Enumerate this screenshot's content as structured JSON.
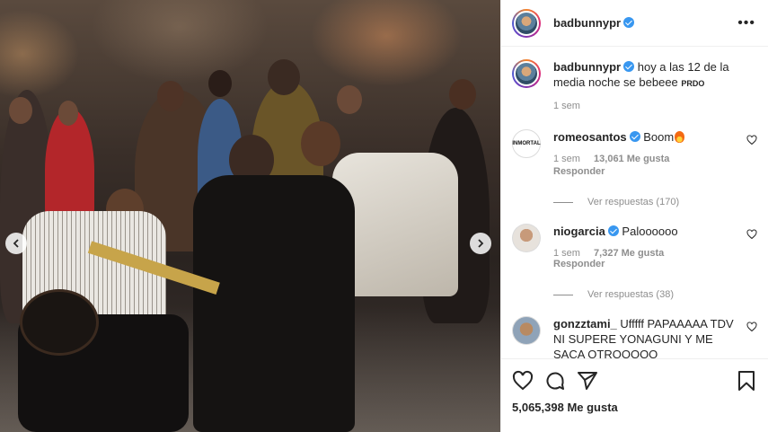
{
  "post": {
    "username": "badbunnypr",
    "caption": "hoy a las 12 de la media noche se bebeee",
    "caption_tag": "PRDO",
    "time": "1 sem",
    "likes": "5,065,398 Me gusta"
  },
  "comments": [
    {
      "username": "romeosantos",
      "verified": true,
      "text": "Boom",
      "time": "1 sem",
      "likes": "13,061 Me gusta",
      "reply": "Responder",
      "replies": "Ver respuestas (170)",
      "avatar_text": "INMORTAL"
    },
    {
      "username": "niogarcia",
      "verified": true,
      "text": "Paloooooo",
      "time": "1 sem",
      "likes": "7,327 Me gusta",
      "reply": "Responder",
      "replies": "Ver respuestas (38)"
    },
    {
      "username": "gonzztami_",
      "verified": false,
      "text": "Ufffff PAPAAAAA TDV NI SUPERE YONAGUNI Y ME SACA OTROOOOO"
    }
  ],
  "icons": {
    "prev": "chevron-left-icon",
    "next": "chevron-right-icon",
    "more": "more-options-icon",
    "like": "heart-icon",
    "comment": "comment-icon",
    "share": "share-icon",
    "save": "bookmark-icon",
    "comment_like": "small-heart-icon",
    "fire": "fire-emoji"
  },
  "colors": {
    "verified": "#3897f0",
    "secondary_text": "#8e8e8e",
    "border": "#efefef"
  }
}
